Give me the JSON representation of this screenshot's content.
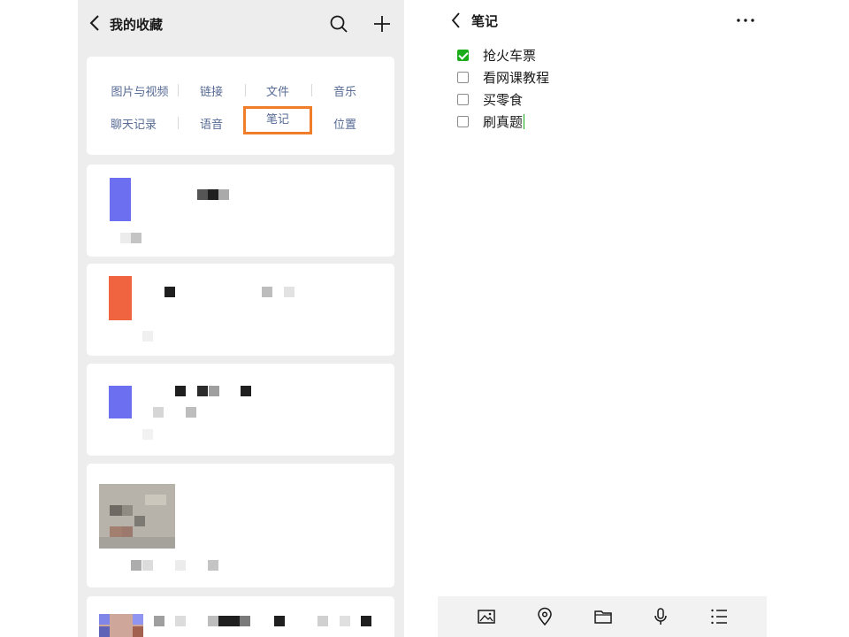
{
  "favorites": {
    "title": "我的收藏",
    "categories_row1": [
      "图片与视频",
      "链接",
      "文件",
      "音乐"
    ],
    "categories_row2": [
      "聊天记录",
      "语音",
      "笔记",
      "位置"
    ],
    "selected_category": "笔记",
    "highlight_color": "#ef7d2a"
  },
  "note": {
    "title": "笔记",
    "items": [
      {
        "text": "抢火车票",
        "checked": true
      },
      {
        "text": "看网课教程",
        "checked": false
      },
      {
        "text": "买零食",
        "checked": false
      },
      {
        "text": "刷真题",
        "checked": false
      }
    ],
    "toolbar": [
      "image-icon",
      "location-icon",
      "folder-icon",
      "microphone-icon",
      "list-icon"
    ]
  },
  "colors": {
    "accent_green": "#1aad19",
    "link_blue": "#576b95",
    "panel_gray": "#ededed"
  }
}
